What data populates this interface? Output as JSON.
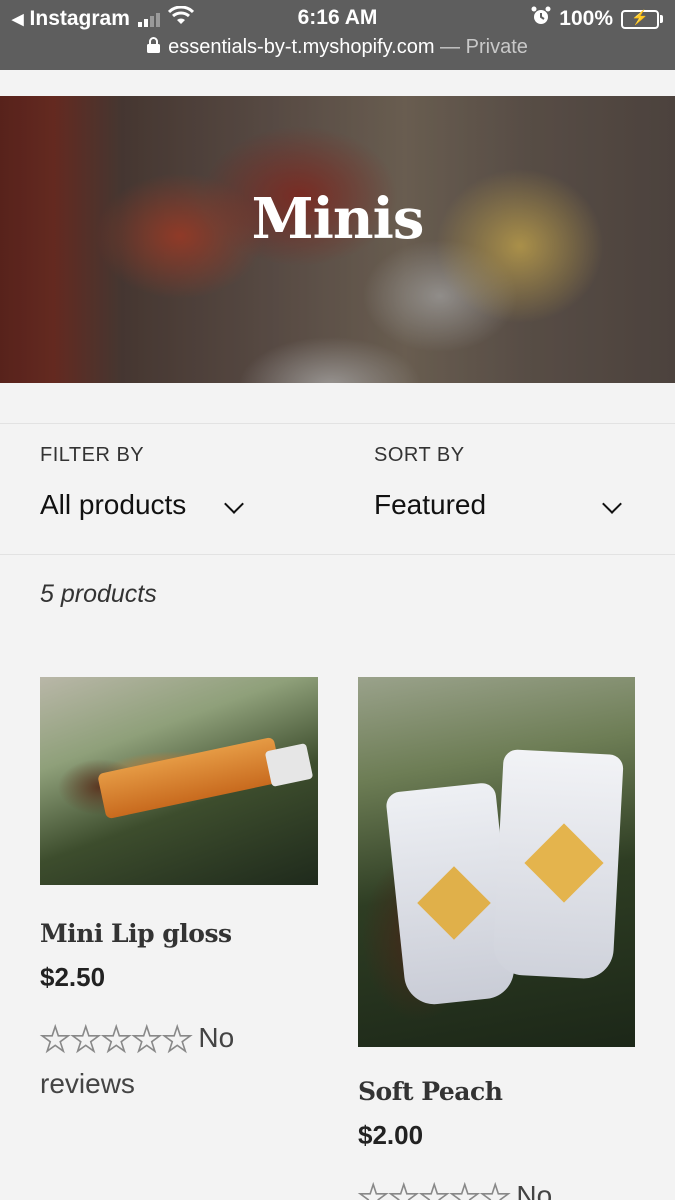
{
  "status_bar": {
    "back_app": "Instagram",
    "time": "6:16 AM",
    "battery": "100%",
    "url": "essentials-by-t.myshopify.com",
    "separator": " — ",
    "private": "Private"
  },
  "hero": {
    "title": "Minis"
  },
  "filter": {
    "label": "FILTER BY",
    "value": "All products"
  },
  "sort": {
    "label": "SORT BY",
    "value": "Featured"
  },
  "product_count": "5 products",
  "products": [
    {
      "name": "Mini Lip gloss",
      "price": "$2.50",
      "rating": 0,
      "reviews_label": "No reviews"
    },
    {
      "name": "Soft Peach",
      "price": "$2.00",
      "rating": 0,
      "reviews_label": "No"
    }
  ],
  "colors": {
    "status_bar_bg": "#5e5e5e",
    "page_bg": "#f3f3f3",
    "battery_green": "#4cd964"
  }
}
